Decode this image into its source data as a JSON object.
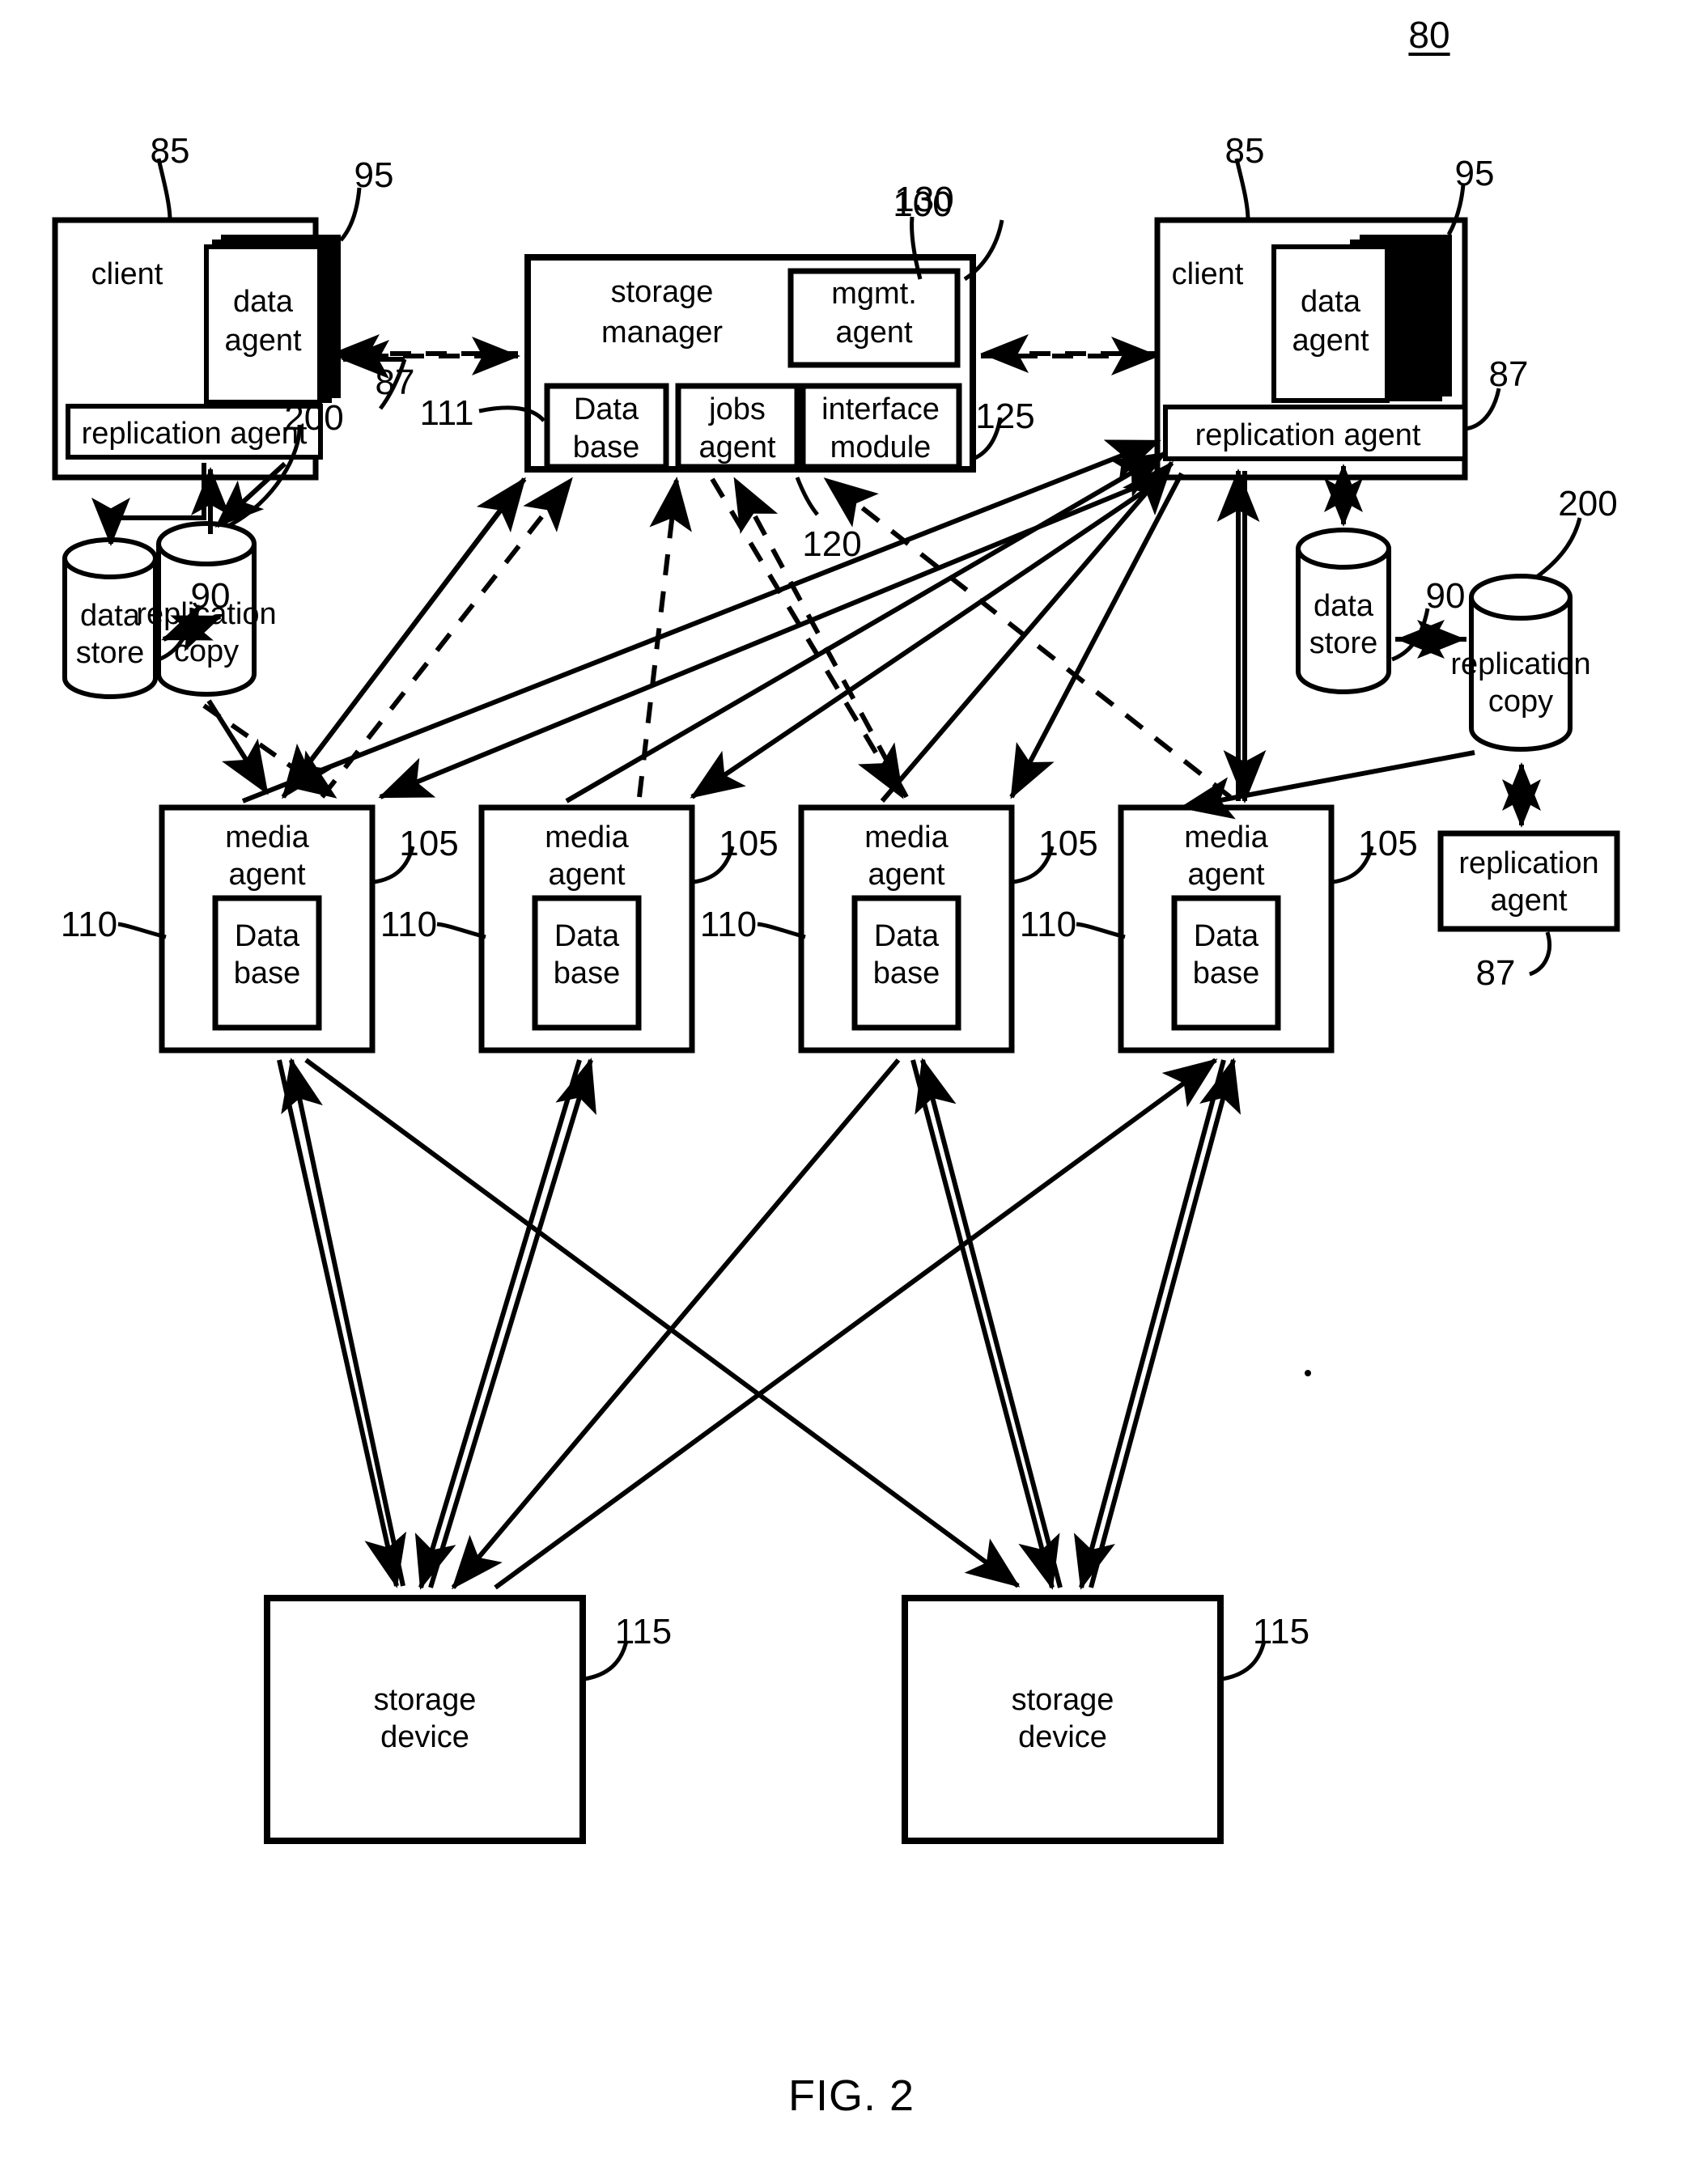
{
  "figure": {
    "caption": "FIG. 2",
    "system_ref": "80"
  },
  "nodes": {
    "client_left": {
      "label": "client",
      "ref": "85",
      "data_agent": {
        "label": "data\nagent",
        "line1": "data",
        "line2": "agent",
        "ref": "95"
      },
      "replication_agent": {
        "label": "replication agent",
        "ref": "87"
      },
      "data_store": {
        "line1": "data",
        "line2": "store",
        "ref": "90"
      },
      "replication_copy": {
        "line1": "replication",
        "line2": "copy",
        "ref": "200"
      }
    },
    "client_right": {
      "label": "client",
      "ref": "85",
      "data_agent": {
        "line1": "data",
        "line2": "agent",
        "ref": "95"
      },
      "replication_agent": {
        "label": "replication agent",
        "ref": "87"
      },
      "data_store": {
        "line1": "data",
        "line2": "store",
        "ref": "90"
      },
      "replication_copy": {
        "line1": "replication",
        "line2": "copy",
        "ref": "200"
      }
    },
    "storage_manager": {
      "line1": "storage",
      "line2": "manager",
      "ref": "100",
      "mgmt_agent": {
        "line1": "mgmt.",
        "line2": "agent",
        "ref": "130"
      },
      "database": {
        "line1": "Data",
        "line2": "base",
        "ref": "111"
      },
      "jobs_agent": {
        "line1": "jobs",
        "line2": "agent",
        "ref": "120"
      },
      "interface_module": {
        "line1": "interface",
        "line2": "module",
        "ref": "125"
      }
    },
    "standalone_replication_agent": {
      "line1": "replication",
      "line2": "agent",
      "ref": "87"
    },
    "media_agents": [
      {
        "line1": "media",
        "line2": "agent",
        "ref": "105",
        "db_line1": "Data",
        "db_line2": "base",
        "db_ref": "110"
      },
      {
        "line1": "media",
        "line2": "agent",
        "ref": "105",
        "db_line1": "Data",
        "db_line2": "base",
        "db_ref": "110"
      },
      {
        "line1": "media",
        "line2": "agent",
        "ref": "105",
        "db_line1": "Data",
        "db_line2": "base",
        "db_ref": "110"
      },
      {
        "line1": "media",
        "line2": "agent",
        "ref": "105",
        "db_line1": "Data",
        "db_line2": "base",
        "db_ref": "110"
      }
    ],
    "storage_devices": [
      {
        "line1": "storage",
        "line2": "device",
        "ref": "115"
      },
      {
        "line1": "storage",
        "line2": "device",
        "ref": "115"
      }
    ]
  },
  "colors": {
    "ink": "#000000",
    "paper": "#ffffff"
  }
}
